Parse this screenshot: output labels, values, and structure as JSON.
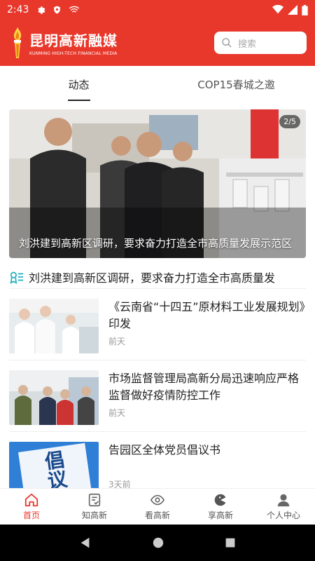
{
  "status": {
    "time": "2:43"
  },
  "header": {
    "logo_name": "昆明高新融媒",
    "logo_sub": "KUNMING HIGH-TECH FINANCIAL MEDIA",
    "search_placeholder": "搜索"
  },
  "tabs": [
    {
      "label": "动态",
      "active": true
    },
    {
      "label": "COP15春城之邀",
      "active": false
    }
  ],
  "banner": {
    "caption": "刘洪建到高新区调研，要求奋力打造全市高质量发展示范区",
    "page_indicator": "2/5"
  },
  "headline": {
    "text": "刘洪建到高新区调研，要求奋力打造全市高质量发"
  },
  "news": [
    {
      "title": "《云南省“十四五”原材料工业发展规划》印发",
      "time": "前天"
    },
    {
      "title": "市场监督管理局高新分局迅速响应严格监督做好疫情防控工作",
      "time": "前天"
    },
    {
      "title": "告园区全体党员倡议书",
      "time": "3天前",
      "thumb_text": "倡议"
    }
  ],
  "bottom_nav": [
    {
      "label": "首页",
      "icon": "home-icon",
      "active": true
    },
    {
      "label": "知高新",
      "icon": "document-icon",
      "active": false
    },
    {
      "label": "看高新",
      "icon": "eye-icon",
      "active": false
    },
    {
      "label": "享高新",
      "icon": "pacman-icon",
      "active": false
    },
    {
      "label": "个人中心",
      "icon": "person-icon",
      "active": false
    }
  ],
  "colors": {
    "brand": "#e8382c",
    "text": "#222222",
    "muted": "#999999"
  }
}
